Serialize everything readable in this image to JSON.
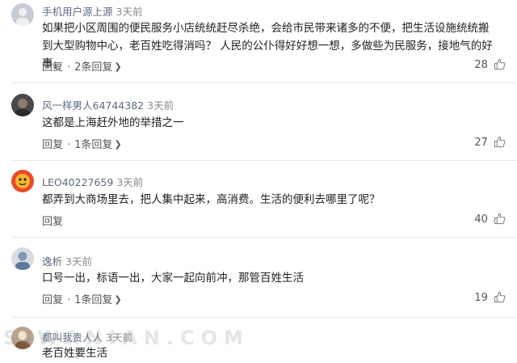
{
  "comments": [
    {
      "username": "手机用户源上源",
      "time": "3天前",
      "text": "如果把小区周围的便民服务小店统统赶尽杀绝，会给市民带来诸多的不便，把生活设施统统搬到大型购物中心，老百姓吃得消吗？ 人民的公仆得好好想一想，多做些为民服务，接地气的好事。",
      "reply_label": "回复",
      "replies": "2条回复",
      "likes": "28"
    },
    {
      "username": "风一样男人64744382",
      "time": "3天前",
      "text": "这都是上海赶外地的举措之一",
      "reply_label": "回复",
      "replies": "1条回复",
      "likes": "27"
    },
    {
      "username": "LEO40227659",
      "time": "3天前",
      "text": "都弄到大商场里去，把人集中起来，高消费。生活的便利去哪里了呢？",
      "reply_label": "回复",
      "replies": "",
      "likes": "40"
    },
    {
      "username": "逸析",
      "time": "3天前",
      "text": "口号一出，标语一出，大家一起向前冲，那管百姓生活",
      "reply_label": "回复",
      "replies": "1条回复",
      "likes": "19"
    },
    {
      "username": "都叫我贵人人",
      "time": "3天前",
      "text": "老百姓要生活"
    }
  ],
  "watermark": "SIWANIAN.COM",
  "colors": {
    "username": "#5b6b80",
    "text": "#222222",
    "divider": "#e9e9e9"
  }
}
